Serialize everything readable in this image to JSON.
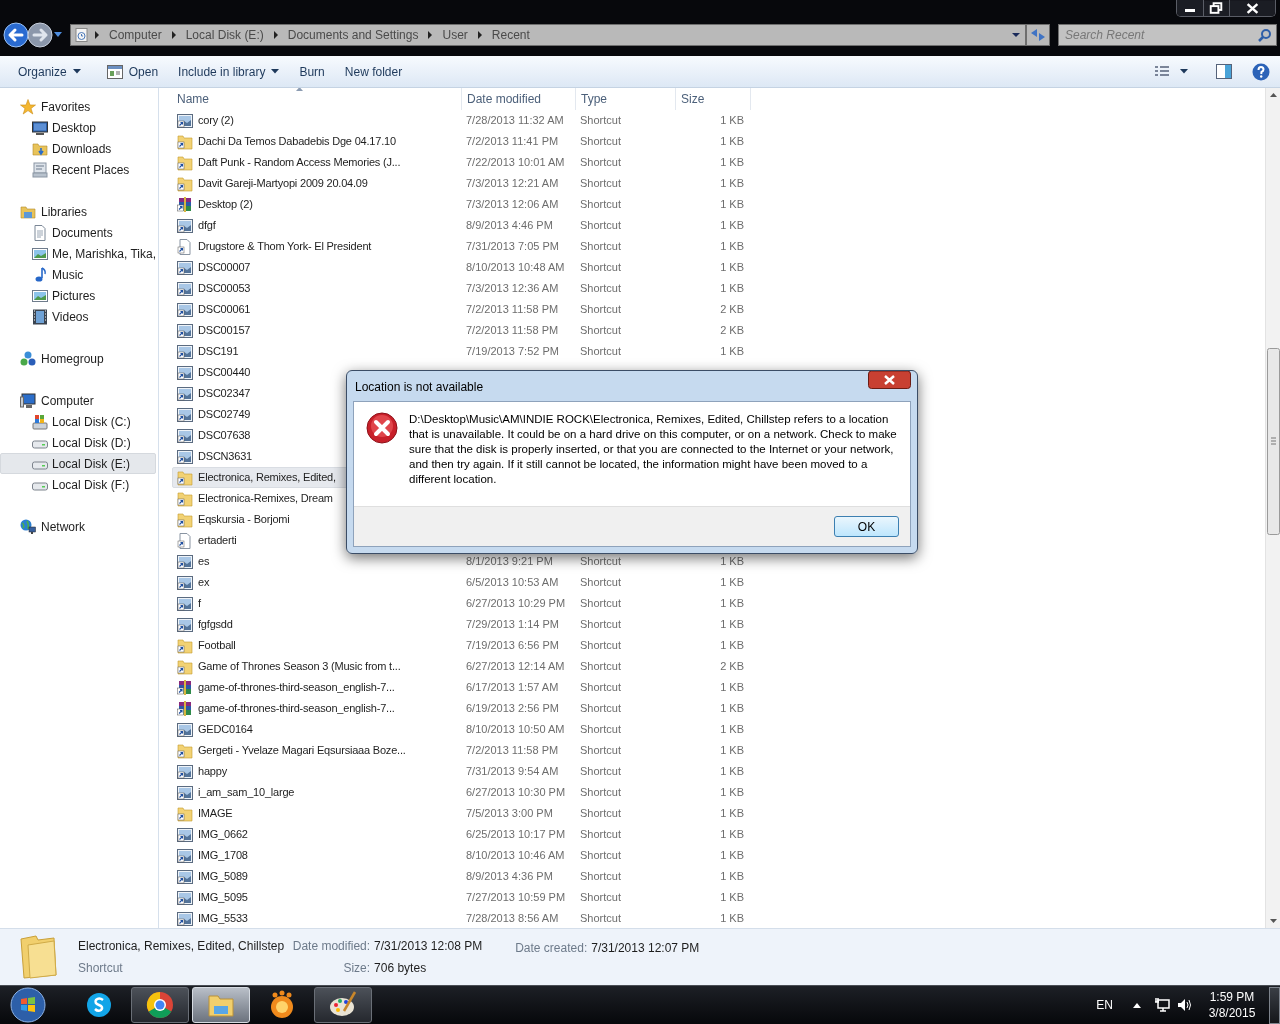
{
  "nav": {
    "breadcrumb": [
      "Computer",
      "Local Disk (E:)",
      "Documents and Settings",
      "User",
      "Recent"
    ],
    "search": {
      "placeholder": "Search Recent"
    }
  },
  "toolbar": {
    "buttons": [
      {
        "label": "Organize",
        "kind": "menu"
      },
      {
        "label": "Open",
        "kind": "icon"
      },
      {
        "label": "Include in library",
        "kind": "menu"
      },
      {
        "label": "Burn",
        "kind": "plain"
      },
      {
        "label": "New folder",
        "kind": "plain"
      }
    ]
  },
  "sidebar": {
    "groups": [
      {
        "label": "Favorites",
        "kind": "star",
        "items": [
          {
            "label": "Desktop",
            "kind": "monitor",
            "selected": false
          },
          {
            "label": "Downloads",
            "kind": "folder",
            "selected": false
          },
          {
            "label": "Recent Places",
            "kind": "places",
            "selected": false
          }
        ]
      },
      {
        "label": "Libraries",
        "kind": "library",
        "items": [
          {
            "label": "Documents",
            "kind": "doc",
            "selected": false
          },
          {
            "label": "Me, Marishka, Tika,",
            "kind": "picture",
            "selected": false
          },
          {
            "label": "Music",
            "kind": "music",
            "selected": false
          },
          {
            "label": "Pictures",
            "kind": "picture",
            "selected": false
          },
          {
            "label": "Videos",
            "kind": "video",
            "selected": false
          }
        ]
      },
      {
        "label": "Homegroup",
        "kind": "homegroup"
      },
      {
        "label": "Computer",
        "kind": "computer",
        "items": [
          {
            "label": "Local Disk (C:)",
            "kind": "system",
            "selected": false
          },
          {
            "label": "Local Disk (D:)",
            "kind": "drive",
            "selected": false
          },
          {
            "label": "Local Disk (E:)",
            "kind": "drive",
            "selected": true
          },
          {
            "label": "Local Disk (F:)",
            "kind": "drive",
            "selected": false
          }
        ]
      },
      {
        "label": "Network",
        "kind": "network"
      }
    ]
  },
  "table": {
    "columns": [
      "Name",
      "Date modified",
      "Type",
      "Size"
    ],
    "rows": [
      {
        "name": "cory (2)",
        "kind": "image",
        "date": "7/28/2013 11:32 AM",
        "type": "Shortcut",
        "size": "1 KB",
        "selected": false
      },
      {
        "name": "Dachi Da Temos Dabadebis Dge 04.17.10",
        "kind": "folder",
        "date": "7/2/2013 11:41 PM",
        "type": "Shortcut",
        "size": "1 KB",
        "selected": false
      },
      {
        "name": "Daft Punk - Random Access Memories (J...",
        "kind": "folder",
        "date": "7/22/2013 10:01 AM",
        "type": "Shortcut",
        "size": "1 KB",
        "selected": false
      },
      {
        "name": "Davit Gareji-Martyopi  2009 20.04.09",
        "kind": "folder",
        "date": "7/3/2013 12:21 AM",
        "type": "Shortcut",
        "size": "1 KB",
        "selected": false
      },
      {
        "name": "Desktop (2)",
        "kind": "archive",
        "date": "7/3/2013 12:06 AM",
        "type": "Shortcut",
        "size": "1 KB",
        "selected": false
      },
      {
        "name": "dfgf",
        "kind": "image",
        "date": "8/9/2013 4:46 PM",
        "type": "Shortcut",
        "size": "1 KB",
        "selected": false
      },
      {
        "name": "Drugstore & Thom York- El President",
        "kind": "file",
        "date": "7/31/2013 7:05 PM",
        "type": "Shortcut",
        "size": "1 KB",
        "selected": false
      },
      {
        "name": "DSC00007",
        "kind": "image",
        "date": "8/10/2013 10:48 AM",
        "type": "Shortcut",
        "size": "1 KB",
        "selected": false
      },
      {
        "name": "DSC00053",
        "kind": "image",
        "date": "7/3/2013 12:36 AM",
        "type": "Shortcut",
        "size": "1 KB",
        "selected": false
      },
      {
        "name": "DSC00061",
        "kind": "image",
        "date": "7/2/2013 11:58 PM",
        "type": "Shortcut",
        "size": "2 KB",
        "selected": false
      },
      {
        "name": "DSC00157",
        "kind": "image",
        "date": "7/2/2013 11:58 PM",
        "type": "Shortcut",
        "size": "2 KB",
        "selected": false
      },
      {
        "name": "DSC191",
        "kind": "image",
        "date": "7/19/2013 7:52 PM",
        "type": "Shortcut",
        "size": "1 KB",
        "selected": false
      },
      {
        "name": "DSC00440",
        "kind": "image",
        "selected": false
      },
      {
        "name": "DSC02347",
        "kind": "image",
        "selected": false
      },
      {
        "name": "DSC02749",
        "kind": "image",
        "selected": false
      },
      {
        "name": "DSC07638",
        "kind": "image",
        "selected": false
      },
      {
        "name": "DSCN3631",
        "kind": "image",
        "selected": false
      },
      {
        "name": "Electronica, Remixes, Edited,",
        "kind": "folder",
        "selected": true
      },
      {
        "name": "Electronica-Remixes, Dream",
        "kind": "folder",
        "selected": false
      },
      {
        "name": "Eqskursia - Borjomi",
        "kind": "folder",
        "selected": false
      },
      {
        "name": "ertaderti",
        "kind": "file",
        "selected": false
      },
      {
        "name": "es",
        "kind": "image",
        "date": "8/1/2013 9:21 PM",
        "type": "Shortcut",
        "size": "1 KB",
        "selected": false
      },
      {
        "name": "ex",
        "kind": "image",
        "date": "6/5/2013 10:53 AM",
        "type": "Shortcut",
        "size": "1 KB",
        "selected": false
      },
      {
        "name": "f",
        "kind": "image",
        "date": "6/27/2013 10:29 PM",
        "type": "Shortcut",
        "size": "1 KB",
        "selected": false
      },
      {
        "name": "fgfgsdd",
        "kind": "image",
        "date": "7/29/2013 1:14 PM",
        "type": "Shortcut",
        "size": "1 KB",
        "selected": false
      },
      {
        "name": "Football",
        "kind": "folder",
        "date": "7/19/2013 6:56 PM",
        "type": "Shortcut",
        "size": "1 KB",
        "selected": false
      },
      {
        "name": "Game of Thrones Season 3 (Music from t...",
        "kind": "folder",
        "date": "6/27/2013 12:14 AM",
        "type": "Shortcut",
        "size": "2 KB",
        "selected": false
      },
      {
        "name": "game-of-thrones-third-season_english-7...",
        "kind": "archive",
        "date": "6/17/2013 1:57 AM",
        "type": "Shortcut",
        "size": "1 KB",
        "selected": false
      },
      {
        "name": "game-of-thrones-third-season_english-7...",
        "kind": "archive",
        "date": "6/19/2013 2:56 PM",
        "type": "Shortcut",
        "size": "1 KB",
        "selected": false
      },
      {
        "name": "GEDC0164",
        "kind": "image",
        "date": "8/10/2013 10:50 AM",
        "type": "Shortcut",
        "size": "1 KB",
        "selected": false
      },
      {
        "name": "Gergeti - Yvelaze Magari Eqsursiaaa Boze...",
        "kind": "folder",
        "date": "7/2/2013 11:58 PM",
        "type": "Shortcut",
        "size": "1 KB",
        "selected": false
      },
      {
        "name": "happy",
        "kind": "image",
        "date": "7/31/2013 9:54 AM",
        "type": "Shortcut",
        "size": "1 KB",
        "selected": false
      },
      {
        "name": "i_am_sam_10_large",
        "kind": "image",
        "date": "6/27/2013 10:30 PM",
        "type": "Shortcut",
        "size": "1 KB",
        "selected": false
      },
      {
        "name": "IMAGE",
        "kind": "folder",
        "date": "7/5/2013 3:00 PM",
        "type": "Shortcut",
        "size": "1 KB",
        "selected": false
      },
      {
        "name": "IMG_0662",
        "kind": "image",
        "date": "6/25/2013 10:17 PM",
        "type": "Shortcut",
        "size": "1 KB",
        "selected": false
      },
      {
        "name": "IMG_1708",
        "kind": "image",
        "date": "8/10/2013 10:46 AM",
        "type": "Shortcut",
        "size": "1 KB",
        "selected": false
      },
      {
        "name": "IMG_5089",
        "kind": "image",
        "date": "8/9/2013 4:36 PM",
        "type": "Shortcut",
        "size": "1 KB",
        "selected": false
      },
      {
        "name": "IMG_5095",
        "kind": "image",
        "date": "7/27/2013 10:59 PM",
        "type": "Shortcut",
        "size": "1 KB",
        "selected": false
      },
      {
        "name": "IMG_5533",
        "kind": "image",
        "date": "7/28/2013 8:56 AM",
        "type": "Shortcut",
        "size": "1 KB",
        "selected": false
      }
    ]
  },
  "dialog": {
    "title": "Location is not available",
    "message": "D:\\Desktop\\Music\\AM\\INDIE ROCK\\Electronica, Remixes, Edited, Chillstep refers to a location that is unavailable. It could be on a hard drive on this computer, or on a network. Check to make sure that the disk is properly inserted, or that you are connected to the Internet or your network, and then try again. If it still cannot be located, the information might have been moved to a different location.",
    "button": "OK"
  },
  "details": {
    "name": "Electronica, Remixes, Edited, Chillstep",
    "type": "Shortcut",
    "fields": [
      {
        "label": "Date modified:",
        "value": "7/31/2013 12:08 PM"
      },
      {
        "label": "Date created:",
        "value": "7/31/2013 12:07 PM"
      },
      {
        "label": "Size:",
        "value": "706 bytes"
      }
    ]
  },
  "taskbar": {
    "apps": [
      {
        "kind": "skype",
        "running": false,
        "selected": false
      },
      {
        "kind": "chrome",
        "running": true,
        "selected": false
      },
      {
        "kind": "explorer",
        "running": true,
        "selected": true
      },
      {
        "kind": "player",
        "running": false,
        "selected": false
      },
      {
        "kind": "paint",
        "running": true,
        "selected": false
      }
    ]
  },
  "tray": {
    "language": "EN",
    "time": "1:59 PM",
    "date": "3/8/2015"
  }
}
